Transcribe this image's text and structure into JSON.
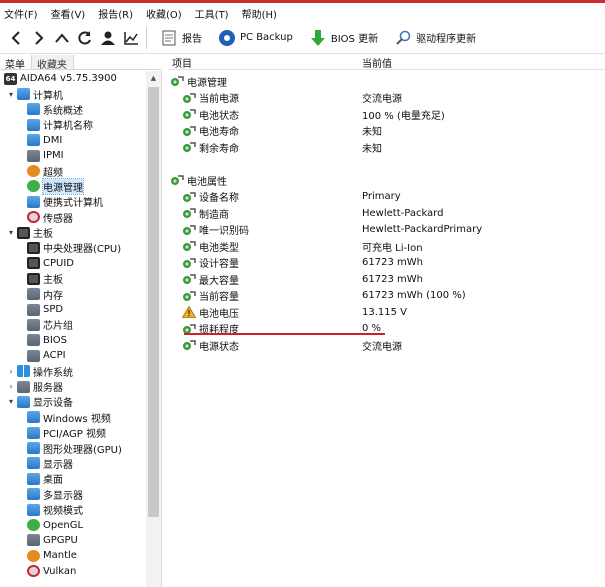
{
  "menu": [
    "文件(F)",
    "查看(V)",
    "报告(R)",
    "收藏(O)",
    "工具(T)",
    "帮助(H)"
  ],
  "toolbar": {
    "report": "报告",
    "pcbackup": "PC Backup",
    "bios": "BIOS 更新",
    "driver": "驱动程序更新"
  },
  "tabs": {
    "menu": "菜单",
    "favorites": "收藏夹"
  },
  "tree": [
    {
      "label": "AIDA64 v5.75.3900",
      "icon": "logo",
      "level": 0,
      "exp": ""
    },
    {
      "label": "计算机",
      "icon": "blue",
      "level": 1,
      "exp": "v"
    },
    {
      "label": "系统概述",
      "icon": "blue",
      "level": 2,
      "exp": ""
    },
    {
      "label": "计算机名称",
      "icon": "blue",
      "level": 2,
      "exp": ""
    },
    {
      "label": "DMI",
      "icon": "blue",
      "level": 2,
      "exp": ""
    },
    {
      "label": "IPMI",
      "icon": "gray",
      "level": 2,
      "exp": ""
    },
    {
      "label": "超频",
      "icon": "orange",
      "level": 2,
      "exp": ""
    },
    {
      "label": "电源管理",
      "icon": "green",
      "level": 2,
      "exp": "",
      "selected": true
    },
    {
      "label": "便携式计算机",
      "icon": "blue",
      "level": 2,
      "exp": ""
    },
    {
      "label": "传感器",
      "icon": "red",
      "level": 2,
      "exp": ""
    },
    {
      "label": "主板",
      "icon": "chip",
      "level": 1,
      "exp": "v"
    },
    {
      "label": "中央处理器(CPU)",
      "icon": "chip",
      "level": 2,
      "exp": ""
    },
    {
      "label": "CPUID",
      "icon": "chip",
      "level": 2,
      "exp": ""
    },
    {
      "label": "主板",
      "icon": "chip",
      "level": 2,
      "exp": ""
    },
    {
      "label": "内存",
      "icon": "gray",
      "level": 2,
      "exp": ""
    },
    {
      "label": "SPD",
      "icon": "gray",
      "level": 2,
      "exp": ""
    },
    {
      "label": "芯片组",
      "icon": "gray",
      "level": 2,
      "exp": ""
    },
    {
      "label": "BIOS",
      "icon": "gray",
      "level": 2,
      "exp": ""
    },
    {
      "label": "ACPI",
      "icon": "gray",
      "level": 2,
      "exp": ""
    },
    {
      "label": "操作系统",
      "icon": "win",
      "level": 1,
      "exp": ">"
    },
    {
      "label": "服务器",
      "icon": "gray",
      "level": 1,
      "exp": ">"
    },
    {
      "label": "显示设备",
      "icon": "blue",
      "level": 1,
      "exp": "v"
    },
    {
      "label": "Windows 视频",
      "icon": "blue",
      "level": 2,
      "exp": ""
    },
    {
      "label": "PCI/AGP 视频",
      "icon": "blue",
      "level": 2,
      "exp": ""
    },
    {
      "label": "图形处理器(GPU)",
      "icon": "blue",
      "level": 2,
      "exp": ""
    },
    {
      "label": "显示器",
      "icon": "blue",
      "level": 2,
      "exp": ""
    },
    {
      "label": "桌面",
      "icon": "blue",
      "level": 2,
      "exp": ""
    },
    {
      "label": "多显示器",
      "icon": "blue",
      "level": 2,
      "exp": ""
    },
    {
      "label": "视频模式",
      "icon": "blue",
      "level": 2,
      "exp": ""
    },
    {
      "label": "OpenGL",
      "icon": "green",
      "level": 2,
      "exp": ""
    },
    {
      "label": "GPGPU",
      "icon": "gray",
      "level": 2,
      "exp": ""
    },
    {
      "label": "Mantle",
      "icon": "orange",
      "level": 2,
      "exp": ""
    },
    {
      "label": "Vulkan",
      "icon": "red",
      "level": 2,
      "exp": ""
    }
  ],
  "header": {
    "item": "项目",
    "value": "当前值"
  },
  "rows": [
    {
      "type": "group",
      "name": "电源管理",
      "value": "",
      "icon": "power"
    },
    {
      "type": "item",
      "name": "当前电源",
      "value": "交流电源",
      "icon": "power"
    },
    {
      "type": "item",
      "name": "电池状态",
      "value": "100 % (电量充足)",
      "icon": "power"
    },
    {
      "type": "item",
      "name": "电池寿命",
      "value": "未知",
      "icon": "power"
    },
    {
      "type": "item",
      "name": "剩余寿命",
      "value": "未知",
      "icon": "power"
    },
    {
      "type": "blank",
      "name": "",
      "value": "",
      "icon": ""
    },
    {
      "type": "group",
      "name": "电池属性",
      "value": "",
      "icon": "power"
    },
    {
      "type": "item",
      "name": "设备名称",
      "value": "Primary",
      "icon": "power"
    },
    {
      "type": "item",
      "name": "制造商",
      "value": "Hewlett-Packard",
      "icon": "power"
    },
    {
      "type": "item",
      "name": "唯一识别码",
      "value": "Hewlett-PackardPrimary",
      "icon": "power"
    },
    {
      "type": "item",
      "name": "电池类型",
      "value": "可充电 Li-Ion",
      "icon": "power"
    },
    {
      "type": "item",
      "name": "设计容量",
      "value": "61723 mWh",
      "icon": "power"
    },
    {
      "type": "item",
      "name": "最大容量",
      "value": "61723 mWh",
      "icon": "power"
    },
    {
      "type": "item",
      "name": "当前容量",
      "value": "61723 mWh  (100 %)",
      "icon": "power"
    },
    {
      "type": "item",
      "name": "电池电压",
      "value": "13.115 V",
      "icon": "warning"
    },
    {
      "type": "item",
      "name": "损耗程度",
      "value": "0 %",
      "icon": "power"
    },
    {
      "type": "item",
      "name": "电源状态",
      "value": "交流电源",
      "icon": "power"
    }
  ],
  "colors": {
    "accent_red": "#d21f2a",
    "selection": "#cde8ff"
  }
}
